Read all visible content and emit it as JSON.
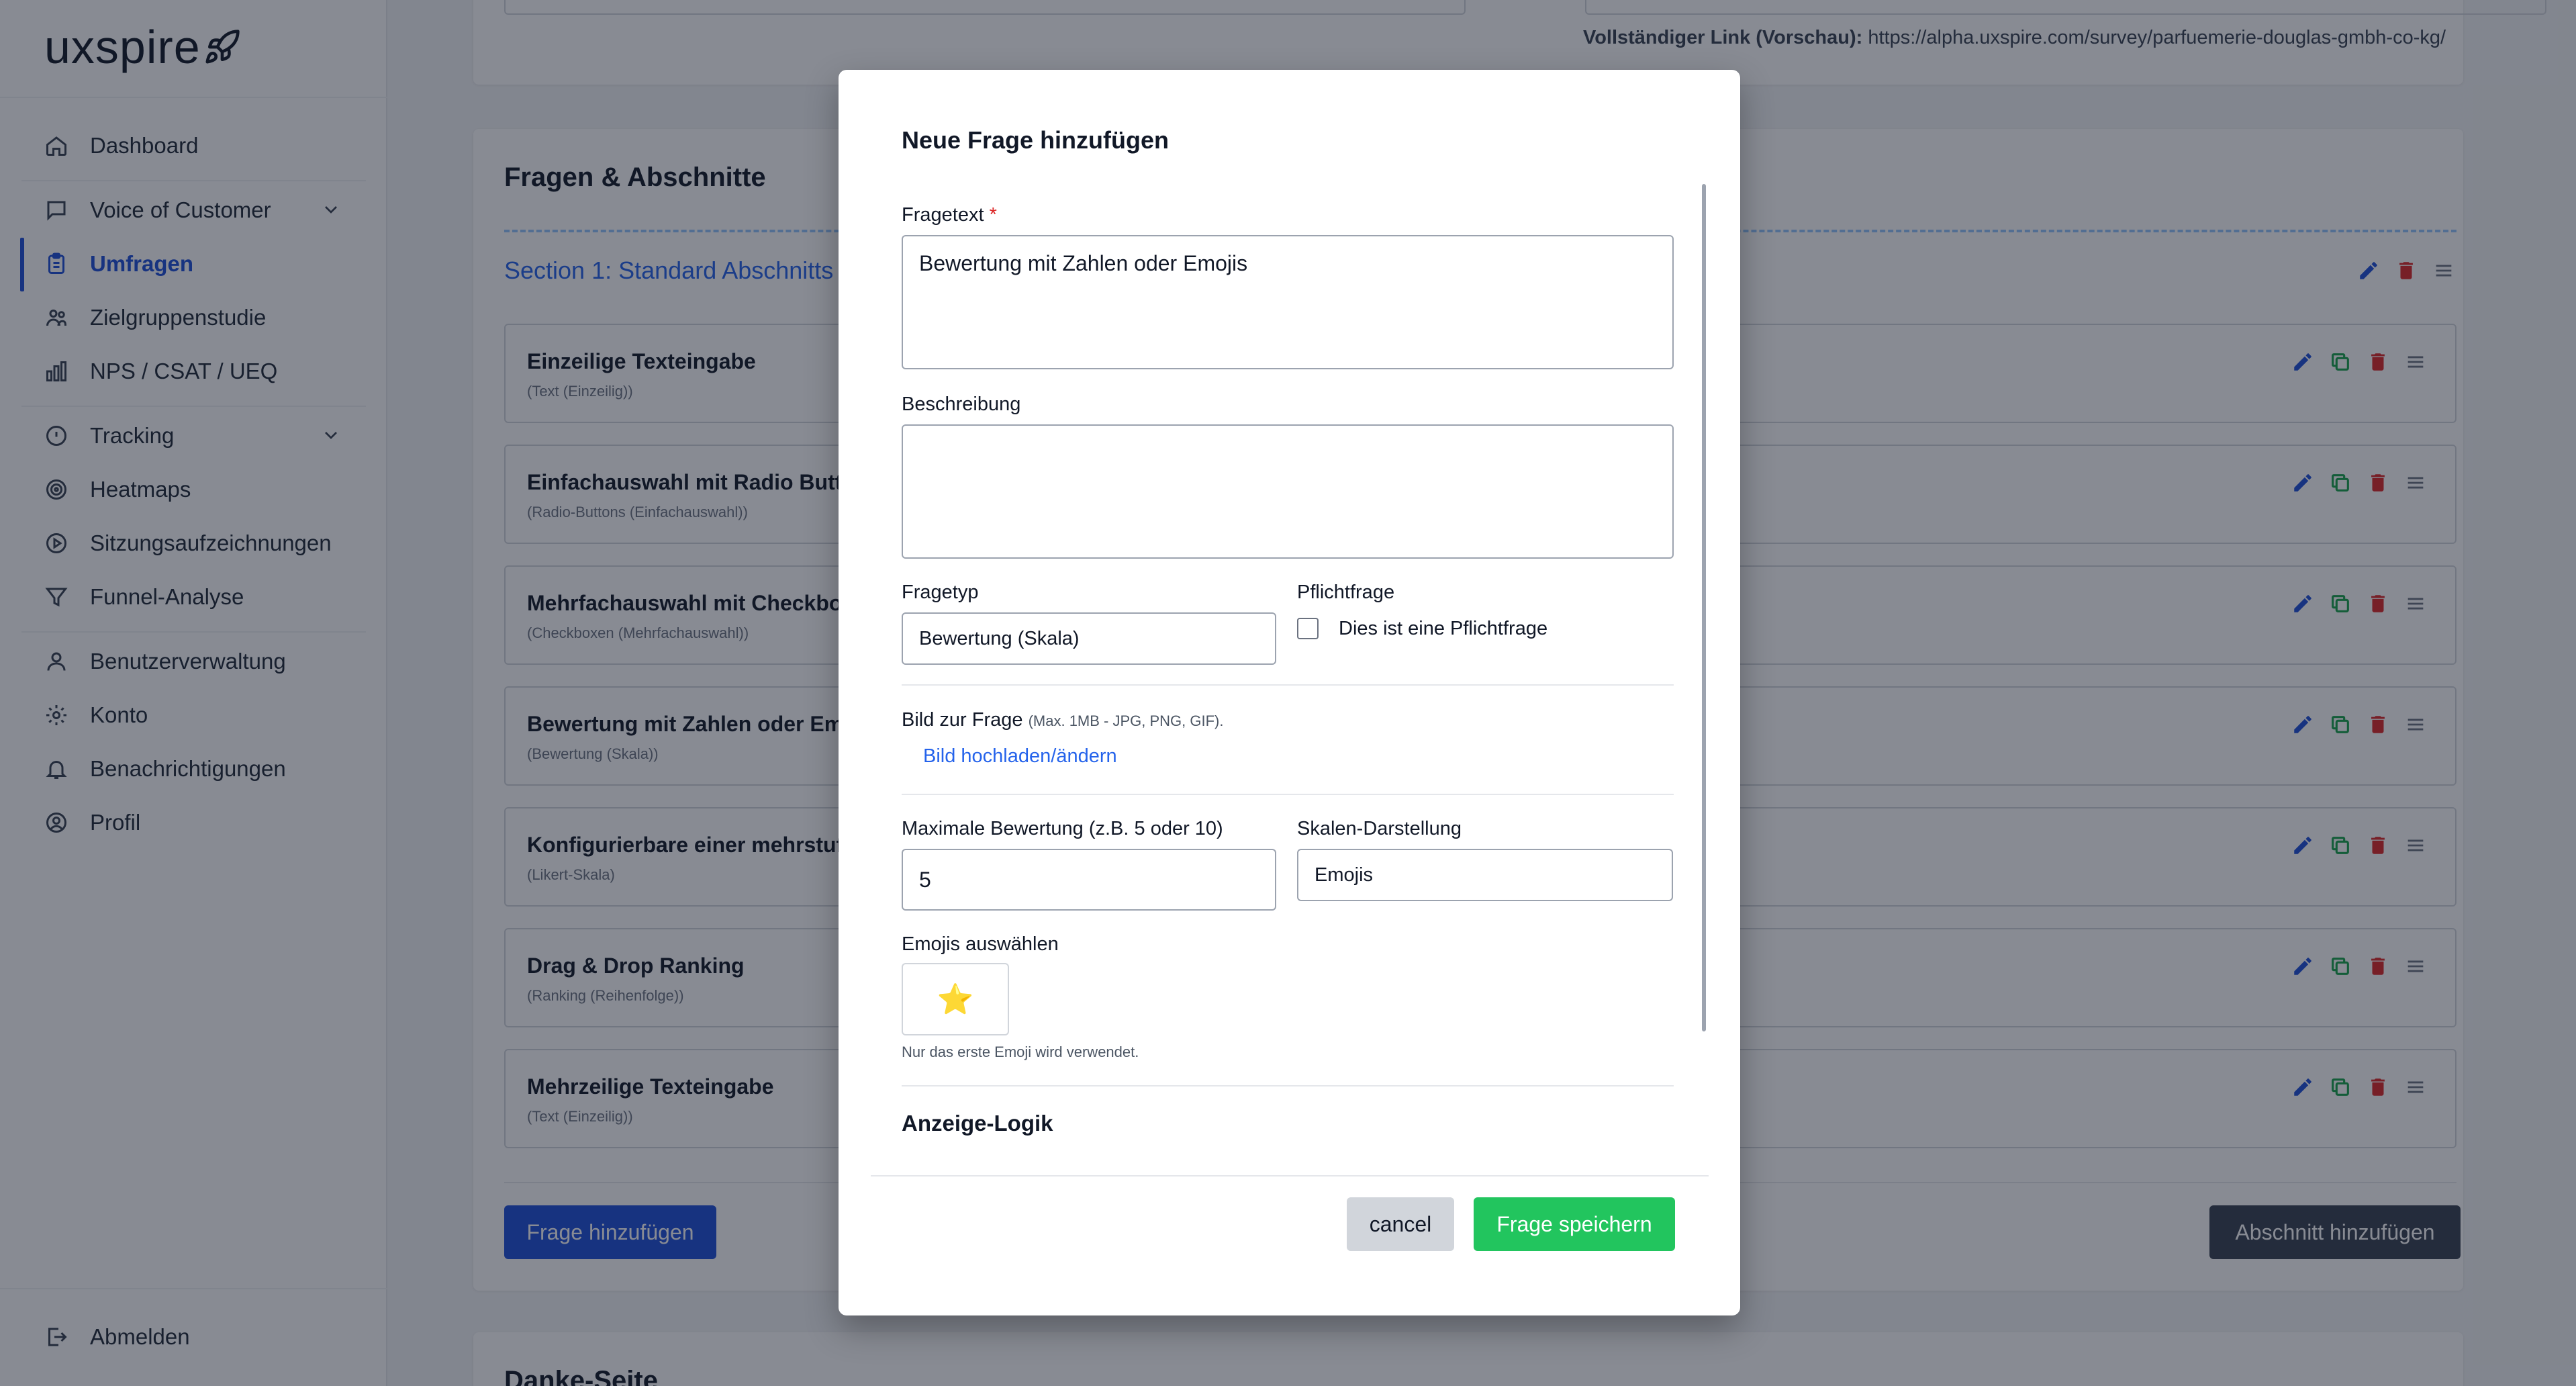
{
  "app": {
    "logo": "uxspire"
  },
  "sidebar": {
    "items": [
      {
        "label": "Dashboard",
        "icon": "home-icon"
      },
      {
        "label": "Voice of Customer",
        "icon": "chat-icon",
        "expandable": true
      },
      {
        "label": "Umfragen",
        "icon": "clipboard-icon",
        "active": true
      },
      {
        "label": "Zielgruppenstudie",
        "icon": "users-icon"
      },
      {
        "label": "NPS / CSAT / UEQ",
        "icon": "bar-chart-icon"
      },
      {
        "label": "Tracking",
        "icon": "info-icon",
        "expandable": true
      },
      {
        "label": "Heatmaps",
        "icon": "heatmap-icon"
      },
      {
        "label": "Sitzungsaufzeichnungen",
        "icon": "play-circle-icon"
      },
      {
        "label": "Funnel-Analyse",
        "icon": "funnel-icon"
      },
      {
        "label": "Benutzerverwaltung",
        "icon": "user-icon"
      },
      {
        "label": "Konto",
        "icon": "gear-icon"
      },
      {
        "label": "Benachrichtigungen",
        "icon": "bell-icon"
      },
      {
        "label": "Profil",
        "icon": "profile-icon"
      }
    ],
    "logout": "Abmelden"
  },
  "main": {
    "link_preview_label": "Vollständiger Link (Vorschau):",
    "link_preview_url": "https://alpha.uxspire.com/survey/parfuemerie-douglas-gmbh-co-kg/",
    "questions_title": "Fragen & Abschnitte",
    "section_title": "Section 1: Standard Abschnitts",
    "questions": [
      {
        "title": "Einzeilige Texteingabe",
        "type": "(Text (Einzeilig))"
      },
      {
        "title": "Einfachauswahl mit Radio Butto",
        "type": "(Radio-Buttons (Einfachauswahl))"
      },
      {
        "title": "Mehrfachauswahl mit Checkbo",
        "type": "(Checkboxen (Mehrfachauswahl))"
      },
      {
        "title": "Bewertung mit Zahlen oder Em",
        "type": "(Bewertung (Skala))"
      },
      {
        "title": "Konfigurierbare einer mehrstuf",
        "type": "(Likert-Skala)"
      },
      {
        "title": "Drag & Drop Ranking",
        "type": "(Ranking (Reihenfolge))"
      },
      {
        "title": "Mehrzeilige Texteingabe",
        "type": "(Text (Einzeilig))"
      }
    ],
    "add_question_button": "Frage hinzufügen",
    "add_section_button": "Abschnitt hinzufügen",
    "thank_you_title": "Danke-Seite"
  },
  "modal": {
    "title": "Neue Frage hinzufügen",
    "question_text_label": "Fragetext",
    "required_mark": "*",
    "question_text_value": "Bewertung mit Zahlen oder Emojis",
    "description_label": "Beschreibung",
    "description_value": "",
    "question_type_label": "Fragetyp",
    "question_type_value": "Bewertung (Skala)",
    "required_label": "Pflichtfrage",
    "required_checkbox_label": "Dies ist eine Pflichtfrage",
    "required_checked": false,
    "image_label": "Bild zur Frage",
    "image_hint": "(Max. 1MB - JPG, PNG, GIF).",
    "image_upload_link": "Bild hochladen/ändern",
    "max_rating_label": "Maximale Bewertung (z.B. 5 oder 10)",
    "max_rating_value": "5",
    "scale_display_label": "Skalen-Darstellung",
    "scale_display_value": "Emojis",
    "emoji_select_label": "Emojis auswählen",
    "emoji_value": "⭐",
    "emoji_hint": "Nur das erste Emoji wird verwendet.",
    "display_logic_title": "Anzeige-Logik",
    "cancel_button": "cancel",
    "save_button": "Frage speichern"
  },
  "colors": {
    "primary": "#1d4ed8",
    "link": "#2563eb",
    "success": "#22c55e",
    "danger": "#dc2626",
    "copy": "#16a34a",
    "dark_button": "#374151"
  }
}
